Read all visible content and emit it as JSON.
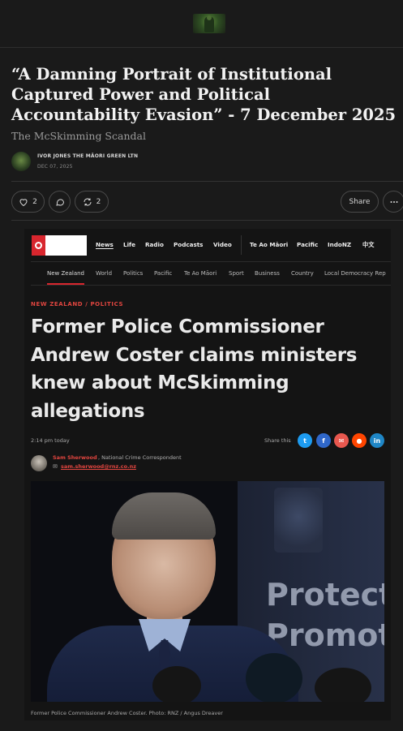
{
  "post": {
    "title": "“A Damning Portrait of Institutional Captured Power and Political Accountability Evasion” - 7 December 2025",
    "subtitle": "The McSkimming Scandal",
    "author": "IVOR JONES THE MĀORI GREEN LTN",
    "date": "DEC 07, 2025"
  },
  "actions": {
    "likes": "2",
    "restacks": "2",
    "share_label": "Share"
  },
  "rnz": {
    "nav": [
      "News",
      "Life",
      "Radio",
      "Podcasts",
      "Video",
      "Te Ao Māori",
      "Pacific",
      "IndoNZ",
      "中文"
    ],
    "subnav": [
      "New Zealand",
      "World",
      "Politics",
      "Pacific",
      "Te Ao Māori",
      "Sport",
      "Business",
      "Country",
      "Local Democracy Rep"
    ]
  },
  "article": {
    "category": "NEW ZEALAND / POLITICS",
    "headline": "Former Police Commissioner Andrew Coster claims ministers knew about McSkimming allegations",
    "time": "2:14 pm today",
    "share_this": "Share this",
    "byline_name": "Sam Sherwood",
    "byline_role": ", National Crime Correspondent",
    "byline_email": "sam.sherwood@rnz.co.nz",
    "photo_text_1": "Protect",
    "photo_text_2": "Promot",
    "caption": "Former Police Commissioner Andrew Coster. Photo: RNZ / Angus Dreaver"
  }
}
